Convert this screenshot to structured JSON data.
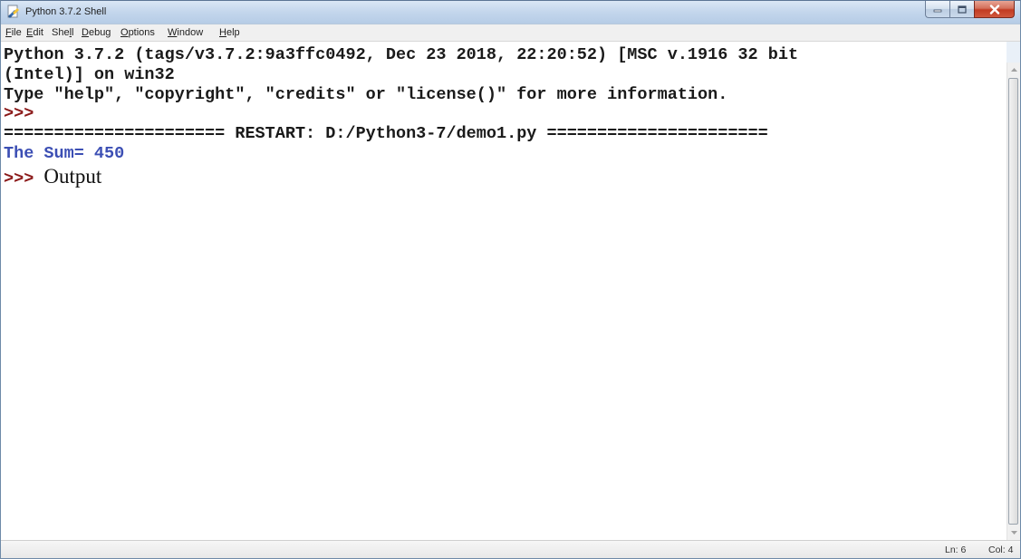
{
  "window": {
    "title": "Python 3.7.2 Shell",
    "icon": "python-idle-icon"
  },
  "menu": {
    "items": [
      {
        "pre": "",
        "acc": "F",
        "post": "ile"
      },
      {
        "pre": "",
        "acc": "E",
        "post": "dit"
      },
      {
        "pre": "She",
        "acc": "l",
        "post": "l"
      },
      {
        "pre": "",
        "acc": "D",
        "post": "ebug"
      },
      {
        "pre": "",
        "acc": "O",
        "post": "ptions"
      },
      {
        "pre": "",
        "acc": "W",
        "post": "indow"
      },
      {
        "pre": "",
        "acc": "H",
        "post": "elp"
      }
    ]
  },
  "shell": {
    "banner_line1": "Python 3.7.2 (tags/v3.7.2:9a3ffc0492, Dec 23 2018, 22:20:52) [MSC v.1916 32 bit",
    "banner_line2": "(Intel)] on win32",
    "banner_line3": "Type \"help\", \"copyright\", \"credits\" or \"license()\" for more information.",
    "prompt": ">>>",
    "restart_line": "====================== RESTART: D:/Python3-7/demo1.py ======================",
    "output_line": "The Sum= 450",
    "annotation": "Output"
  },
  "status": {
    "line": "Ln: 6",
    "col": "Col: 4"
  },
  "colors": {
    "prompt": "#8a1818",
    "program_output": "#3c4fb4",
    "close_button": "#c23b22"
  }
}
